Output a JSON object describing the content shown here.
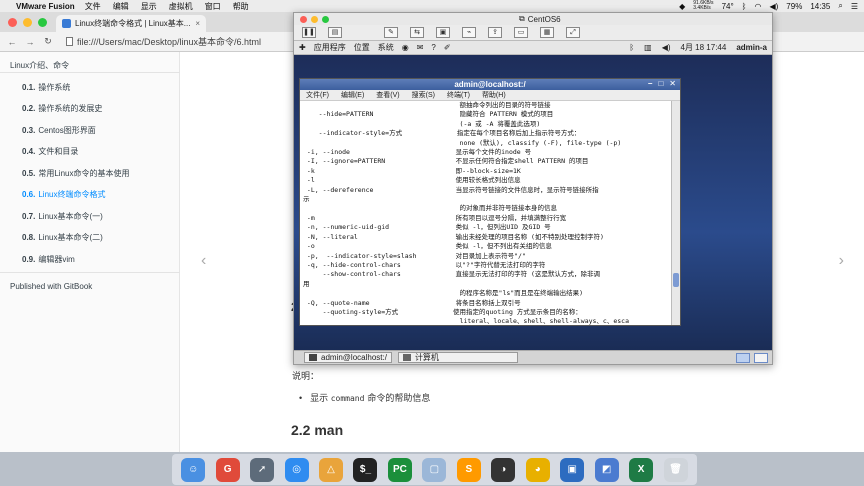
{
  "menubar": {
    "app": "VMware Fusion",
    "items": [
      "文件",
      "编辑",
      "显示",
      "虚拟机",
      "窗口",
      "帮助"
    ],
    "net_up": "91.6KB/s",
    "net_down": "3.4KB/s",
    "temp": "74°",
    "battery": "79%",
    "time": "14:35"
  },
  "browser": {
    "tab_title": "Linux终端命令格式 | Linux基本...",
    "url": "file:///Users/mac/Desktop/linux基本命令/6.html"
  },
  "sidebar": {
    "header": "Linux介绍、命令",
    "items": [
      {
        "num": "0.1.",
        "label": "操作系统"
      },
      {
        "num": "0.2.",
        "label": "操作系统的发展史"
      },
      {
        "num": "0.3.",
        "label": "Centos图形界面"
      },
      {
        "num": "0.4.",
        "label": "文件和目录"
      },
      {
        "num": "0.5.",
        "label": "常用Linux命令的基本使用"
      },
      {
        "num": "0.6.",
        "label": "Linux终端命令格式"
      },
      {
        "num": "0.7.",
        "label": "Linux基本命令(一)"
      },
      {
        "num": "0.8.",
        "label": "Linux基本命令(二)"
      },
      {
        "num": "0.9.",
        "label": "编辑器vim"
      }
    ],
    "published": "Published with GitBook"
  },
  "content": {
    "note_label": "说明：",
    "bullet_prefix": "显示",
    "bullet_code": "command",
    "bullet_suffix": "命令的帮助信息",
    "heading": "2.2 man",
    "partial_heading": "2"
  },
  "vm": {
    "title": "CentOS6",
    "panel_apps": "应用程序",
    "panel_places": "位置",
    "panel_system": "系统",
    "panel_date": "4月 18 17:44",
    "panel_user": "admin-a",
    "taskbar_terminal": "admin@localhost:/",
    "taskbar_calc": "计算机"
  },
  "terminal": {
    "title": "admin@localhost:/",
    "menu": [
      "文件(F)",
      "编辑(E)",
      "查看(V)",
      "搜索(S)",
      "终端(T)",
      "帮助(H)"
    ],
    "lines": [
      "                                        额抽命令列出的目录的符号链接",
      "    --hide=PATTERN                      隐藏符合 PATTERN 模式的项目",
      "                                        (-a 或 -A 将覆盖此选项)",
      "    --indicator-style=方式              指定在每个项目名称后加上指示符号方式：",
      "                                        none (默认), classify (-F), file-type (-p)",
      " -i, --inode                           显示每个文件的inode 号",
      " -I, --ignore=PATTERN                  不显示任何符合指定shell PATTERN 的项目",
      " -k                                    即--block-size=1K",
      " -l                                    使用较长格式列出信息",
      " -L, --dereference                     当显示符号链接的文件信息时，显示符号链接所指",
      "示",
      "                                        的对象而并非符号链接本身的信息",
      " -m                                    所有项目以逗号分隔，并填满整行行宽",
      " -n, --numeric-uid-gid                 类似 -l，但列出UID 及GID 号",
      " -N, --literal                         输出未经处理的项目名称 (如不特别处理控制字符)",
      " -o                                    类似 -l，但不列出有关组的信息",
      " -p,  --indicator-style=slash          对目录加上表示符号\"/\"",
      " -q, --hide-control-chars              以\"?\"字符代替无法打印的字符",
      "     --show-control-chars              直接显示无法打印的字符 (这是默认方式，除非调",
      "用",
      "                                        的程序名称是\"ls\"而且是在终端输出结果)",
      " -Q, --quote-name                      将条目名称括上双引号",
      "     --quoting-style=方式              使用指定的quoting 方式显示条目的名称：",
      "                                        literal、locale、shell、shell-always、c、esca"
    ]
  },
  "dock": {
    "icons": [
      "finder-icon",
      "gitkraken-icon",
      "launchpad-icon",
      "safari-icon",
      "vim-icon",
      "terminal-icon",
      "pycharm-icon",
      "preview-icon",
      "sublime-icon",
      "obs-icon",
      "chrome-icon",
      "vmware-icon",
      "virtualbox-icon",
      "excel-icon",
      "trash-icon"
    ]
  },
  "colors": {
    "active_link": "#008cff",
    "centos_desktop": "#2b4b8c"
  }
}
